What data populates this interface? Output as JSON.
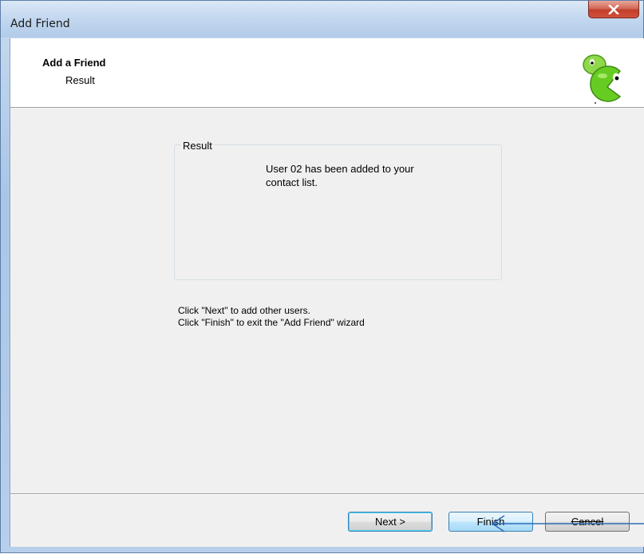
{
  "window": {
    "title": "Add Friend"
  },
  "header": {
    "title": "Add a Friend",
    "subtitle": "Result",
    "logo_icon": "smiley-mascot-icon"
  },
  "result_group": {
    "label": "Result",
    "message_line1": "User 02 has been added to your",
    "message_line2": "contact list."
  },
  "instructions": {
    "line1": "Click \"Next\" to add other users.",
    "line2": "Click \"Finish\" to exit the \"Add Friend\" wizard"
  },
  "buttons": {
    "next": "Next >",
    "finish": "Finish",
    "cancel": "Cancel"
  },
  "colors": {
    "accent": "#3c7fb1",
    "close": "#c23e2a",
    "logo_green": "#66cc22"
  }
}
